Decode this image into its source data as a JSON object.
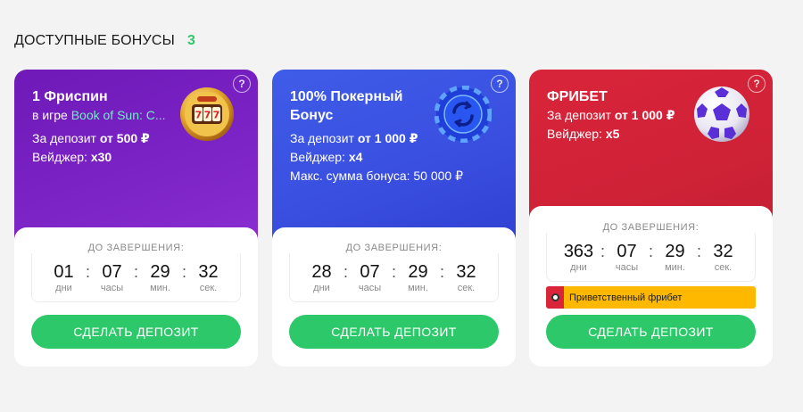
{
  "header": {
    "title": "ДОСТУПНЫЕ БОНУСЫ",
    "count": "3"
  },
  "timer_label": "ДО ЗАВЕРШЕНИЯ:",
  "units": {
    "days": "дни",
    "hours": "часы",
    "minutes": "мин.",
    "seconds": "сек."
  },
  "help_symbol": "?",
  "cards": [
    {
      "title": "1 Фриспин",
      "game_prefix": "в игре",
      "game_name": "Book of Sun: C...",
      "deposit_label": "За депозит",
      "deposit_value": "от 500 ₽",
      "wager_label": "Вейджер:",
      "wager_value": "x30",
      "icon": "slot-machine-icon",
      "timer": {
        "days": "01",
        "hours": "07",
        "minutes": "29",
        "seconds": "32"
      },
      "button": "СДЕЛАТЬ ДЕПОЗИТ",
      "accent": "#7a22c4"
    },
    {
      "title": "100% Покерный Бонус",
      "deposit_label": "За депозит",
      "deposit_value": "от 1 000 ₽",
      "wager_label": "Вейджер:",
      "wager_value": "x4",
      "max_label": "Макс. сумма бонуса:",
      "max_value": "50 000 ₽",
      "icon": "poker-chip-icon",
      "timer": {
        "days": "28",
        "hours": "07",
        "minutes": "29",
        "seconds": "32"
      },
      "button": "СДЕЛАТЬ ДЕПОЗИТ",
      "accent": "#3a4fe0"
    },
    {
      "title": "ФРИБЕТ",
      "deposit_label": "За депозит",
      "deposit_value": "от 1 000 ₽",
      "wager_label": "Вейджер:",
      "wager_value": "x5",
      "icon": "soccer-ball-icon",
      "timer": {
        "days": "363",
        "hours": "07",
        "minutes": "29",
        "seconds": "32"
      },
      "promo": "Приветственный фрибет",
      "button": "СДЕЛАТЬ ДЕПОЗИТ",
      "accent": "#cf2237"
    }
  ],
  "colors": {
    "button_green": "#2dc86a",
    "count_green": "#2fc86b",
    "promo_yellow": "#ffb800",
    "game_link": "#6ff0c6"
  }
}
